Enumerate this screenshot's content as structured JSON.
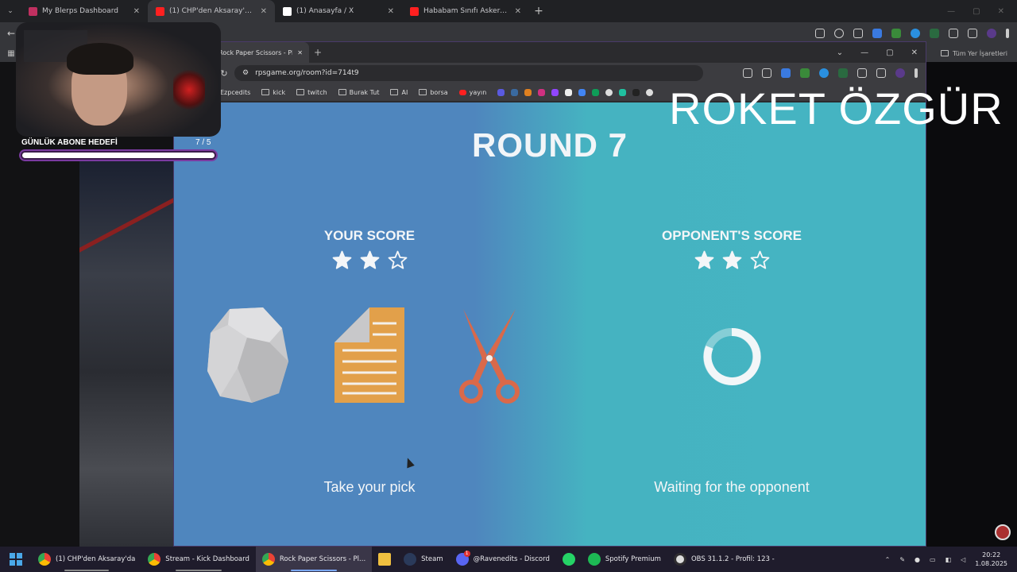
{
  "outer_browser": {
    "tabs": [
      {
        "label": "My Blerps Dashboard",
        "color": "#c03060"
      },
      {
        "label": "(1) CHP'den Aksaray'da \"M...",
        "color": "#ff2020"
      },
      {
        "label": "(1) Anasayfa / X",
        "color": "#ffffff"
      },
      {
        "label": "Hababam Sınıfı Askerde | Şafak",
        "color": "#ff2020"
      }
    ],
    "all_bookmarks": "Tüm Yer İşaretleri"
  },
  "inner_browser": {
    "tab_label": "Rock Paper Scissors - Play Onli...",
    "url": "rpsgame.org/room?id=714t9",
    "bookmarks": [
      "Ezpcedits",
      "kick",
      "twitch",
      "Burak Tut",
      "AI",
      "borsa",
      "yayın"
    ]
  },
  "game": {
    "round_label": "ROUND 7",
    "your_score_label": "YOUR SCORE",
    "opponent_score_label": "OPPONENT'S SCORE",
    "your_stars_filled": 2,
    "opponent_stars_filled": 2,
    "stars_total": 3,
    "choices": [
      {
        "name": "rock"
      },
      {
        "name": "paper"
      },
      {
        "name": "scissors"
      }
    ],
    "take_pick": "Take your pick",
    "waiting": "Waiting for the opponent",
    "colors": {
      "bg_left": "#4f86be",
      "bg_right": "#45b4c2",
      "paper": "#e2a04a",
      "scissors": "#d9694a"
    }
  },
  "overlay": {
    "goal_label": "GÜNLÜK ABONE HEDEFİ",
    "goal_count": "7  / 5",
    "goal_progress": 1.0,
    "streamer_name": "ROKET ÖZGÜR"
  },
  "taskbar": {
    "items": [
      {
        "label": "(1) CHP'den Aksaray'da",
        "color": "#4285f4"
      },
      {
        "label": "Stream - Kick Dashboard",
        "color": "#4285f4"
      },
      {
        "label": "Rock Paper Scissors - Pl...",
        "color": "#4285f4"
      },
      {
        "label": "",
        "color": "#f0c040"
      },
      {
        "label": "Steam",
        "color": "#1b2838"
      },
      {
        "label": "@Ravenedits - Discord",
        "color": "#5865f2"
      },
      {
        "label": "",
        "color": "#25d366"
      },
      {
        "label": "Spotify Premium",
        "color": "#1db954"
      },
      {
        "label": "OBS 31.1.2 - Profil: 123 -",
        "color": "#302e31"
      }
    ],
    "time": "20:22",
    "date": "1.08.2025"
  }
}
